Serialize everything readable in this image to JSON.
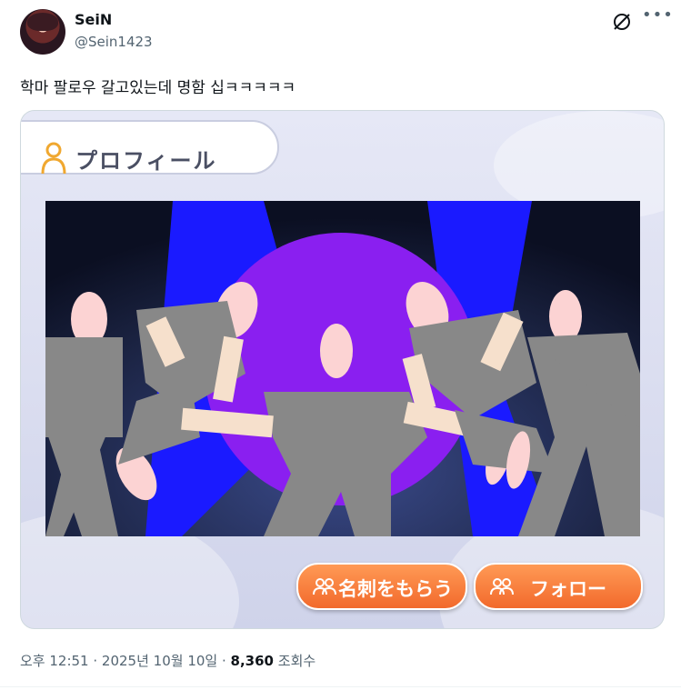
{
  "author": {
    "display_name": "SeiN",
    "handle": "@Sein1423"
  },
  "tweet": {
    "text": "학마 팔로우 갈고있는데 명함 십ㅋㅋㅋㅋㅋ"
  },
  "media": {
    "profile_title": "プロフィール",
    "buttons": {
      "meishi": "名刺をもらう",
      "follow": "フォロー"
    },
    "colors": {
      "button_orange": "#f26a2c",
      "stage_purple": "#8a1ff0",
      "stage_blue": "#1a1aff",
      "figure_gray": "#888888",
      "skin_pink": "#fcd3d3"
    }
  },
  "meta": {
    "time": "오후 12:51",
    "separator": " · ",
    "date": "2025년 10월 10일",
    "views_count": "8,360",
    "views_label": "조회수"
  },
  "icons": {
    "grok": "grok-icon",
    "more": "more-options-icon",
    "person": "person-icon",
    "group": "group-icon"
  }
}
